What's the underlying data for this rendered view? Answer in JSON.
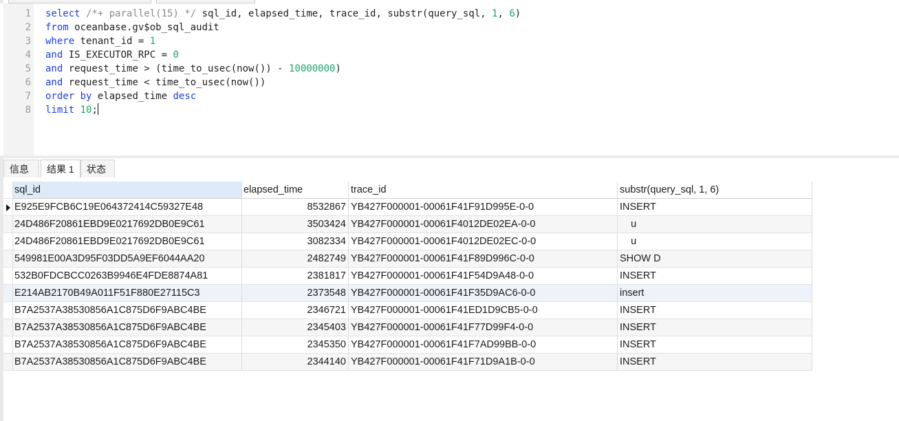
{
  "editor": {
    "line_numbers": [
      "1",
      "2",
      "3",
      "4",
      "5",
      "6",
      "7",
      "8"
    ],
    "lines": [
      {
        "tokens": [
          {
            "t": "select",
            "c": "kw"
          },
          {
            "t": " "
          },
          {
            "t": "/*+ parallel(15) */",
            "c": "cm"
          },
          {
            "t": " sql_id, elapsed_time, trace_id, substr(query_sql, "
          },
          {
            "t": "1",
            "c": "nm"
          },
          {
            "t": ", "
          },
          {
            "t": "6",
            "c": "nm"
          },
          {
            "t": ")"
          }
        ]
      },
      {
        "tokens": [
          {
            "t": "from",
            "c": "kw"
          },
          {
            "t": " oceanbase.gv$ob_sql_audit"
          }
        ]
      },
      {
        "tokens": [
          {
            "t": "where",
            "c": "kw"
          },
          {
            "t": " tenant_id = "
          },
          {
            "t": "1",
            "c": "nm"
          }
        ]
      },
      {
        "tokens": [
          {
            "t": "and",
            "c": "kw"
          },
          {
            "t": " IS_EXECUTOR_RPC = "
          },
          {
            "t": "0",
            "c": "nm"
          }
        ]
      },
      {
        "tokens": [
          {
            "t": "and",
            "c": "kw"
          },
          {
            "t": " request_time > (time_to_usec(now()) - "
          },
          {
            "t": "10000000",
            "c": "nm"
          },
          {
            "t": ")"
          }
        ]
      },
      {
        "tokens": [
          {
            "t": "and",
            "c": "kw"
          },
          {
            "t": " request_time < time_to_usec(now())"
          }
        ]
      },
      {
        "tokens": [
          {
            "t": "order",
            "c": "kw"
          },
          {
            "t": " "
          },
          {
            "t": "by",
            "c": "kw"
          },
          {
            "t": " elapsed_time "
          },
          {
            "t": "desc",
            "c": "kw"
          }
        ]
      },
      {
        "tokens": [
          {
            "t": "limit",
            "c": "kw"
          },
          {
            "t": " "
          },
          {
            "t": "10",
            "c": "nm"
          },
          {
            "t": ";"
          }
        ],
        "caret": true
      }
    ]
  },
  "tabs": [
    {
      "label": "信息",
      "active": false
    },
    {
      "label": "结果 1",
      "active": true
    },
    {
      "label": "状态",
      "active": false
    }
  ],
  "grid": {
    "columns": [
      "sql_id",
      "elapsed_time",
      "trace_id",
      "substr(query_sql, 1, 6)"
    ],
    "rows": [
      [
        "E925E9FCB6C19E064372414C59327E48",
        "8532867",
        "YB427F000001-00061F41F91D995E-0-0",
        "INSERT"
      ],
      [
        "24D486F20861EBD9E0217692DB0E9C61",
        "3503424",
        "YB427F000001-00061F4012DE02EA-0-0",
        "    u"
      ],
      [
        "24D486F20861EBD9E0217692DB0E9C61",
        "3082334",
        "YB427F000001-00061F4012DE02EC-0-0",
        "    u"
      ],
      [
        "549981E00A3D95F03DD5A9EF6044AA20",
        "2482749",
        "YB427F000001-00061F41F89D996C-0-0",
        "SHOW D"
      ],
      [
        "532B0FDCBCC0263B9946E4FDE8874A81",
        "2381817",
        "YB427F000001-00061F41F54D9A48-0-0",
        "INSERT"
      ],
      [
        "E214AB2170B49A011F51F880E27115C3",
        "2373548",
        "YB427F000001-00061F41F35D9AC6-0-0",
        "insert"
      ],
      [
        "B7A2537A38530856A1C875D6F9ABC4BE",
        "2346721",
        "YB427F000001-00061F41ED1D9CB5-0-0",
        "INSERT"
      ],
      [
        "B7A2537A38530856A1C875D6F9ABC4BE",
        "2345403",
        "YB427F000001-00061F41F77D99F4-0-0",
        "INSERT"
      ],
      [
        "B7A2537A38530856A1C875D6F9ABC4BE",
        "2345350",
        "YB427F000001-00061F41F7AD99BB-0-0",
        "INSERT"
      ],
      [
        "B7A2537A38530856A1C875D6F9ABC4BE",
        "2344140",
        "YB427F000001-00061F41F71D9A1B-0-0",
        "INSERT"
      ]
    ],
    "current_row": 0,
    "selected_row": 5
  },
  "colors": {
    "keyword": "#1d3ee0",
    "comment": "#8a8a8a",
    "number": "#1aa36a",
    "header_selected": "#dcebf7"
  }
}
